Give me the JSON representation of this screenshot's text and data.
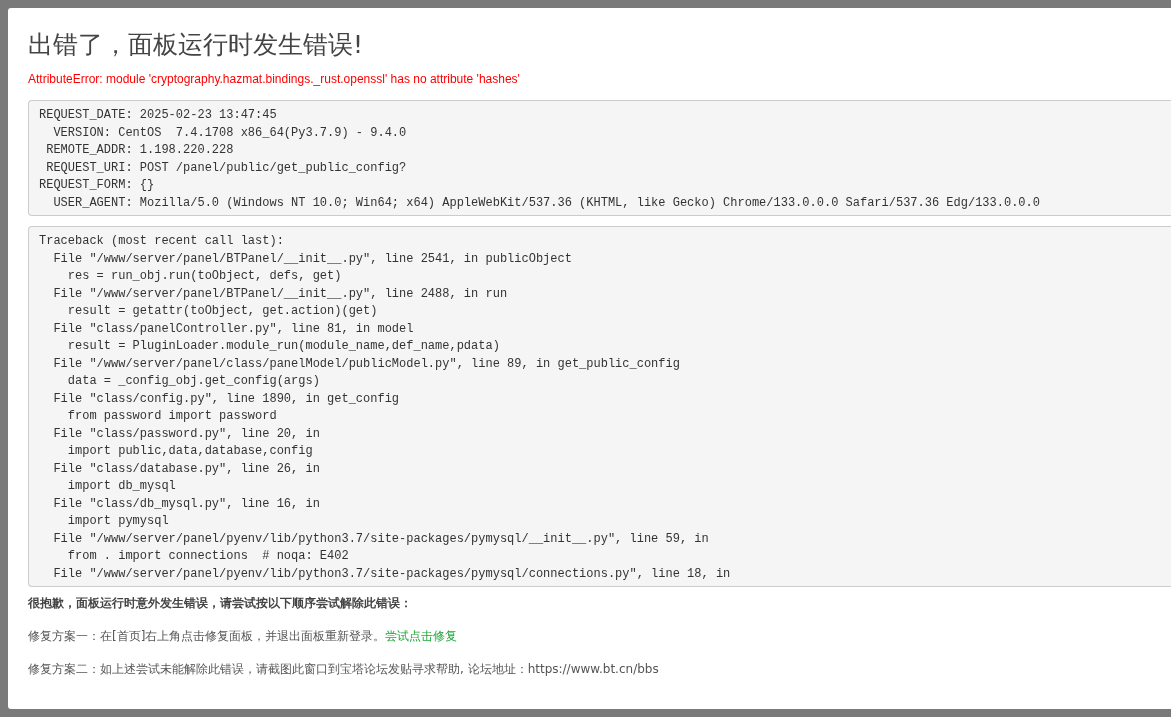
{
  "dialog": {
    "title": "出错了，面板运行时发生错误!",
    "error_message": "AttributeError: module 'cryptography.hazmat.bindings._rust.openssl' has no attribute 'hashes'"
  },
  "request_info": {
    "lines": [
      "REQUEST_DATE: 2025-02-23 13:47:45",
      "  VERSION: CentOS  7.4.1708 x86_64(Py3.7.9) - 9.4.0",
      " REMOTE_ADDR: 1.198.220.228",
      " REQUEST_URI: POST /panel/public/get_public_config?",
      "REQUEST_FORM: {}",
      "  USER_AGENT: Mozilla/5.0 (Windows NT 10.0; Win64; x64) AppleWebKit/537.36 (KHTML, like Gecko) Chrome/133.0.0.0 Safari/537.36 Edg/133.0.0.0"
    ]
  },
  "traceback": {
    "lines": [
      "Traceback (most recent call last):",
      "  File \"/www/server/panel/BTPanel/__init__.py\", line 2541, in publicObject",
      "    res = run_obj.run(toObject, defs, get)",
      "  File \"/www/server/panel/BTPanel/__init__.py\", line 2488, in run",
      "    result = getattr(toObject, get.action)(get)",
      "  File \"class/panelController.py\", line 81, in model",
      "    result = PluginLoader.module_run(module_name,def_name,pdata)",
      "  File \"/www/server/panel/class/panelModel/publicModel.py\", line 89, in get_public_config",
      "    data = _config_obj.get_config(args)",
      "  File \"class/config.py\", line 1890, in get_config",
      "    from password import password",
      "  File \"class/password.py\", line 20, in",
      "    import public,data,database,config",
      "  File \"class/database.py\", line 26, in",
      "    import db_mysql",
      "  File \"class/db_mysql.py\", line 16, in",
      "    import pymysql",
      "  File \"/www/server/panel/pyenv/lib/python3.7/site-packages/pymysql/__init__.py\", line 59, in",
      "    from . import connections  # noqa: E402",
      "  File \"/www/server/panel/pyenv/lib/python3.7/site-packages/pymysql/connections.py\", line 18, in"
    ]
  },
  "help": {
    "heading": "很抱歉，面板运行时意外发生错误，请尝试按以下顺序尝试解除此错误：",
    "options": [
      {
        "text": "修复方案一：在[首页]右上角点击修复面板，并退出面板重新登录。",
        "link": "尝试点击修复"
      },
      {
        "text": "修复方案二：如上述尝试未能解除此错误，请截图此窗口到宝塔论坛发贴寻求帮助, 论坛地址：https://www.bt.cn/bbs"
      }
    ]
  }
}
